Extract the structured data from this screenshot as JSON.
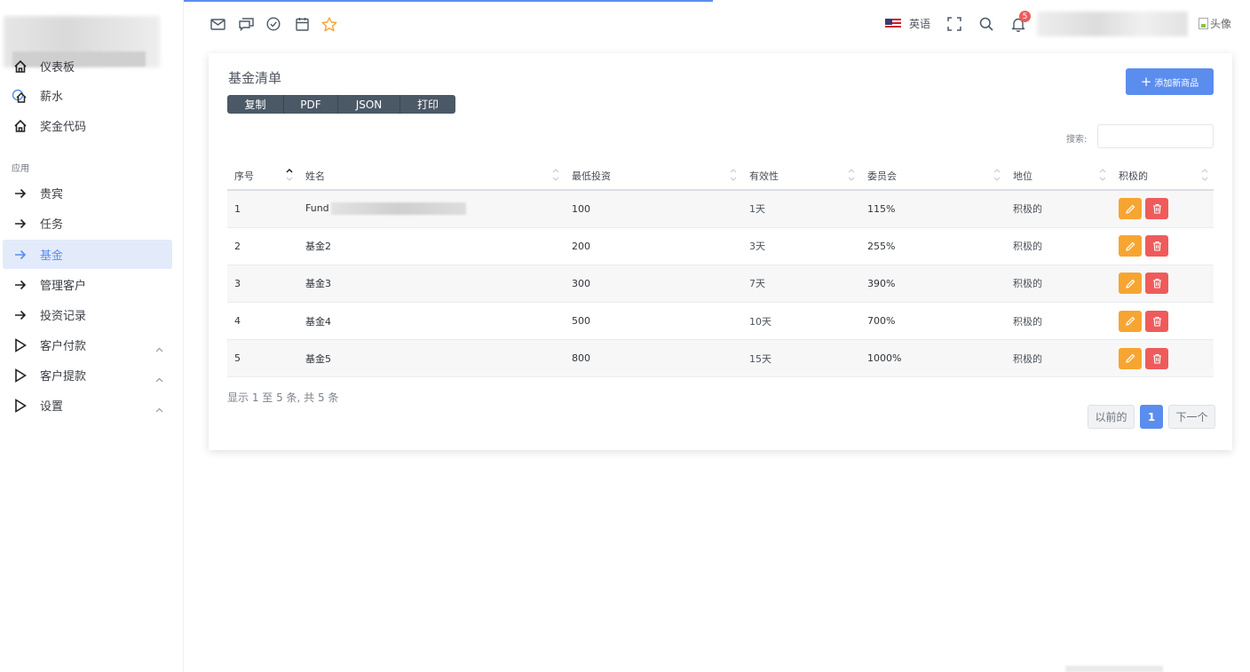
{
  "sidebar": {
    "items": [
      {
        "label": "仪表板",
        "icon": "home-icon"
      },
      {
        "label": "薪水",
        "icon": "cloud-home-icon"
      },
      {
        "label": "奖金代码",
        "icon": "home-icon"
      }
    ],
    "section_label": "应用",
    "apps": [
      {
        "label": "贵宾",
        "icon": "arrow-right-icon",
        "active": false
      },
      {
        "label": "任务",
        "icon": "arrow-right-icon",
        "active": false
      },
      {
        "label": "基金",
        "icon": "arrow-right-icon",
        "active": true
      },
      {
        "label": "管理客户",
        "icon": "arrow-right-icon",
        "active": false
      },
      {
        "label": "投资记录",
        "icon": "arrow-right-icon",
        "active": false
      },
      {
        "label": "客户付款",
        "icon": "play-outline-icon",
        "expandable": true
      },
      {
        "label": "客户提款",
        "icon": "play-outline-icon",
        "expandable": true
      },
      {
        "label": "设置",
        "icon": "play-outline-icon",
        "expandable": true
      }
    ]
  },
  "header": {
    "left_icons": [
      "mail-icon",
      "chat-icon",
      "check-circle-icon",
      "calendar-icon",
      "star-icon"
    ],
    "language": "英语",
    "notification_count": "5",
    "avatar_alt": "头像"
  },
  "card": {
    "title": "基金清单",
    "export_buttons": [
      "复制",
      "PDF",
      "JSON",
      "打印"
    ],
    "add_button": "添加新商品",
    "search_label": "搜索:",
    "columns": [
      "序号",
      "姓名",
      "最低投资",
      "有效性",
      "委员会",
      "地位",
      "积极的"
    ],
    "rows": [
      {
        "id": "1",
        "name": "Fund",
        "min": "100",
        "validity": "1天",
        "commission": "115%",
        "status": "积极的"
      },
      {
        "id": "2",
        "name": "基金2",
        "min": "200",
        "validity": "3天",
        "commission": "255%",
        "status": "积极的"
      },
      {
        "id": "3",
        "name": "基金3",
        "min": "300",
        "validity": "7天",
        "commission": "390%",
        "status": "积极的"
      },
      {
        "id": "4",
        "name": "基金4",
        "min": "500",
        "validity": "10天",
        "commission": "700%",
        "status": "积极的"
      },
      {
        "id": "5",
        "name": "基金5",
        "min": "800",
        "validity": "15天",
        "commission": "1000%",
        "status": "积极的"
      }
    ],
    "info": "显示 1 至 5 条, 共 5 条",
    "pager": {
      "prev": "以前的",
      "current": "1",
      "next": "下一个"
    }
  },
  "colors": {
    "accent": "#5b8def",
    "edit": "#f7a531",
    "delete": "#ef5b5b",
    "export": "#4b5866"
  }
}
